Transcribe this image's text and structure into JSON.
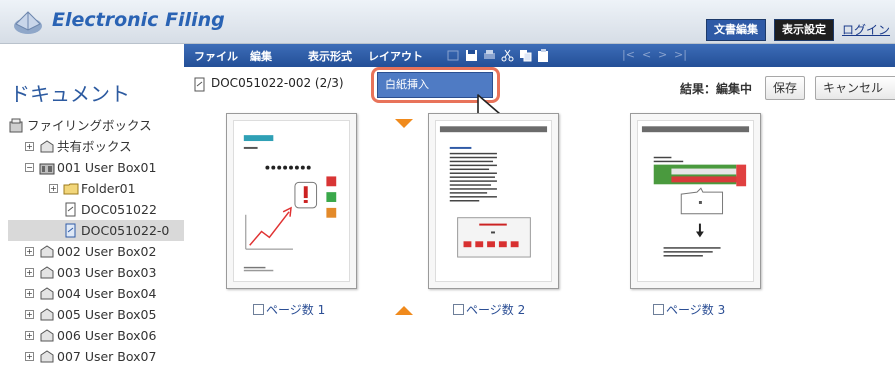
{
  "header": {
    "title": "Electronic Filing",
    "doc_edit_label": "文書編集",
    "display_settings_label": "表示設定",
    "login_label": "ログイン"
  },
  "menu": {
    "items": [
      "ファイル",
      "編集",
      "表示形式",
      "レイアウト"
    ]
  },
  "sidebar": {
    "title": "ドキュメント",
    "tree": [
      {
        "label": "ファイリングボックス",
        "icon": "filing-box-icon"
      },
      {
        "label": "共有ボックス",
        "icon": "shared-box-icon"
      },
      {
        "label": "001 User Box01",
        "icon": "user-box-icon"
      },
      {
        "label": "Folder01",
        "icon": "folder-icon"
      },
      {
        "label": "DOC051022",
        "icon": "document-icon"
      },
      {
        "label": "DOC051022-0",
        "icon": "document-icon"
      },
      {
        "label": "002 User Box02",
        "icon": "user-box-icon"
      },
      {
        "label": "003 User Box03",
        "icon": "user-box-icon"
      },
      {
        "label": "004 User Box04",
        "icon": "user-box-icon"
      },
      {
        "label": "005 User Box05",
        "icon": "user-box-icon"
      },
      {
        "label": "006 User Box06",
        "icon": "user-box-icon"
      },
      {
        "label": "007 User Box07",
        "icon": "user-box-icon"
      }
    ]
  },
  "content": {
    "document_name": "DOC051022-002 (2/3)",
    "popup_item": "白紙挿入",
    "result_text": "結果：編集中",
    "save_label": "保存",
    "cancel_label": "キャンセル",
    "pages": [
      {
        "label": "ページ数 1"
      },
      {
        "label": "ページ数 2"
      },
      {
        "label": "ページ数 3"
      }
    ]
  },
  "colors": {
    "brand": "#2a63b4",
    "menubar": "#2f5aa6",
    "highlight": "#e8735a",
    "insert_marker": "#f08a1c"
  }
}
